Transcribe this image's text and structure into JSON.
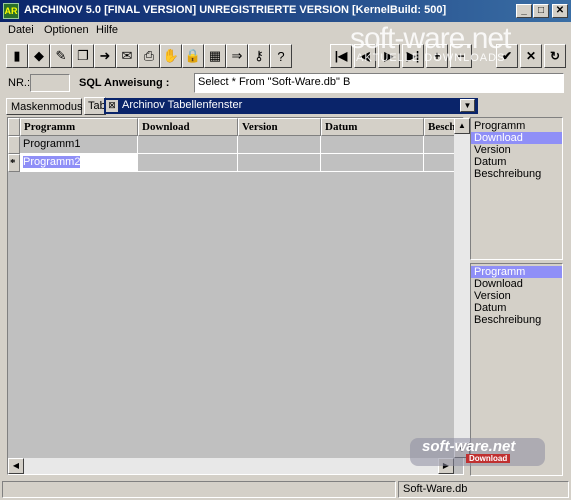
{
  "window": {
    "title": "ARCHINOV 5.0 [FINAL VERSION] UNREGISTRIERTE VERSION [KernelBuild: 500]",
    "app_icon": "AR",
    "minimize": "_",
    "maximize": "□",
    "close": "✕"
  },
  "menu": [
    "Datei",
    "Optionen",
    "Hilfe"
  ],
  "toolbar": {
    "tools": [
      "save-icon",
      "eraser-icon",
      "edit-icon",
      "copy-icon",
      "paste-icon",
      "doc-icon",
      "print-icon",
      "tools-icon",
      "lock-icon",
      "calc-icon",
      "export-icon",
      "key-icon",
      "help-icon"
    ],
    "tool_glyphs": [
      "▮",
      "◆",
      "✎",
      "❐",
      "➜",
      "✉",
      "⎙",
      "✋",
      "🔒",
      "▦",
      "⇒",
      "⚷",
      "?"
    ],
    "nav": [
      {
        "name": "first-record",
        "glyph": "|◀"
      },
      {
        "name": "prev-record",
        "glyph": "◀"
      },
      {
        "name": "next-record",
        "glyph": "▶"
      },
      {
        "name": "last-record",
        "glyph": "▶|"
      },
      {
        "name": "add-record",
        "glyph": "+"
      },
      {
        "name": "remove-record",
        "glyph": "−"
      },
      {
        "name": "post-record",
        "glyph": "✔"
      },
      {
        "name": "cancel-record",
        "glyph": "✕"
      },
      {
        "name": "refresh-record",
        "glyph": "↻"
      }
    ]
  },
  "watermark_top": {
    "text": "soft-ware.net",
    "sub": "AKTUELLE DOWNLOADS"
  },
  "sql": {
    "nr_label": "NR.:",
    "sql_label": "SQL Anweisung :",
    "sql_value": "Select * From \"Soft-Ware.db\" B"
  },
  "tabs": {
    "maske": "Maskenmodus",
    "tab": "Tabelle"
  },
  "inner_window": {
    "title": "Archinov Tabellenfenster",
    "icon": "⊠",
    "dropdown": "▼"
  },
  "grid": {
    "columns": [
      "Programm",
      "Download",
      "Version",
      "Datum",
      "Beschreibung"
    ],
    "rows": [
      {
        "indicator": "",
        "cells": [
          "Programm1",
          "",
          "",
          "",
          ""
        ]
      },
      {
        "indicator": "*",
        "cells": [
          "Programm2",
          "",
          "",
          "",
          ""
        ]
      }
    ]
  },
  "list_top": {
    "items": [
      "Programm",
      "Download",
      "Version",
      "Datum",
      "Beschreibung"
    ],
    "selected": 1
  },
  "list_bottom": {
    "items": [
      "Programm",
      "Download",
      "Version",
      "Datum",
      "Beschreibung"
    ],
    "selected": 0
  },
  "watermark_bottom": {
    "text": "soft-ware.net",
    "sub": "Download"
  },
  "status": {
    "panel_text": "Soft-Ware.db"
  }
}
